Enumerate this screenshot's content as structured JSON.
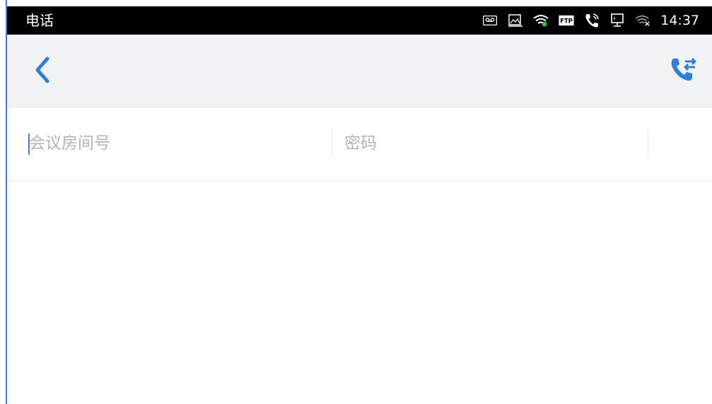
{
  "status_bar": {
    "app_name": "电话",
    "time": "14:37",
    "icons": [
      "voicemail-icon",
      "image-icon",
      "wifi-icon",
      "ftp-icon",
      "call-icon",
      "monitor-icon",
      "wifi-off-icon"
    ],
    "ftp_label": "FTP"
  },
  "toolbar": {
    "back_icon": "chevron-left-icon",
    "transfer_icon": "call-transfer-icon",
    "accent_color": "#2f7fd8"
  },
  "form": {
    "room_number": {
      "value": "",
      "placeholder": "会议房间号"
    },
    "password": {
      "value": "",
      "placeholder": "密码"
    }
  }
}
